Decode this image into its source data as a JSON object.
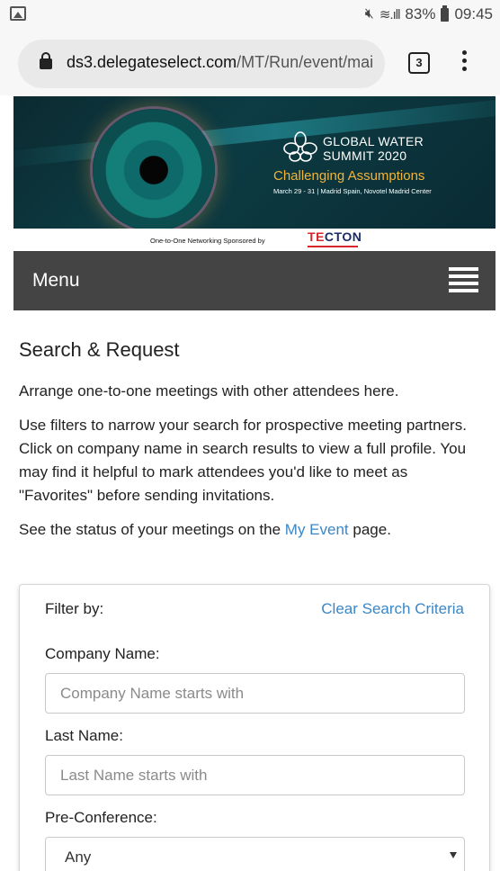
{
  "status_bar": {
    "battery": "83%",
    "time": "09:45",
    "icons": [
      "image-icon",
      "mute-icon",
      "wifi-icon",
      "signal-icon",
      "battery-icon"
    ]
  },
  "browser": {
    "url_domain": "ds3.delegateselect.com",
    "url_path": "/MT/Run/event/mai",
    "tab_count": "3"
  },
  "banner": {
    "title_line1": "GLOBAL WATER",
    "title_line2": "SUMMIT 2020",
    "tagline": "Challenging Assumptions",
    "details": "March 29 - 31  |  Madrid Spain, Novotel Madrid Center",
    "sponsor_text": "One-to-One Networking Sponsored by",
    "sponsor_logo": "TECTON",
    "colors": {
      "tagline": "#f2b437",
      "background": "#0d3c44"
    }
  },
  "menu": {
    "label": "Menu"
  },
  "page": {
    "title": "Search & Request",
    "intro": "Arrange one-to-one meetings with other attendees here.",
    "help": "Use filters to narrow your search for prospective meeting partners. Click on company name in search results to view a full profile. You may find it helpful to mark attendees you'd like to meet as \"Favorites\" before sending invitations.",
    "status_prefix": "See the status of your meetings on the ",
    "status_link": "My Event",
    "status_suffix": " page."
  },
  "filter": {
    "heading": "Filter by:",
    "clear_label": "Clear Search Criteria",
    "company_label": "Company Name:",
    "company_placeholder": "Company Name starts with",
    "lastname_label": "Last Name:",
    "lastname_placeholder": "Last Name starts with",
    "preconf_label": "Pre-Conference:",
    "preconf_value": "Any"
  },
  "colors": {
    "link": "#3a87c8",
    "menu_bar": "#444444"
  }
}
